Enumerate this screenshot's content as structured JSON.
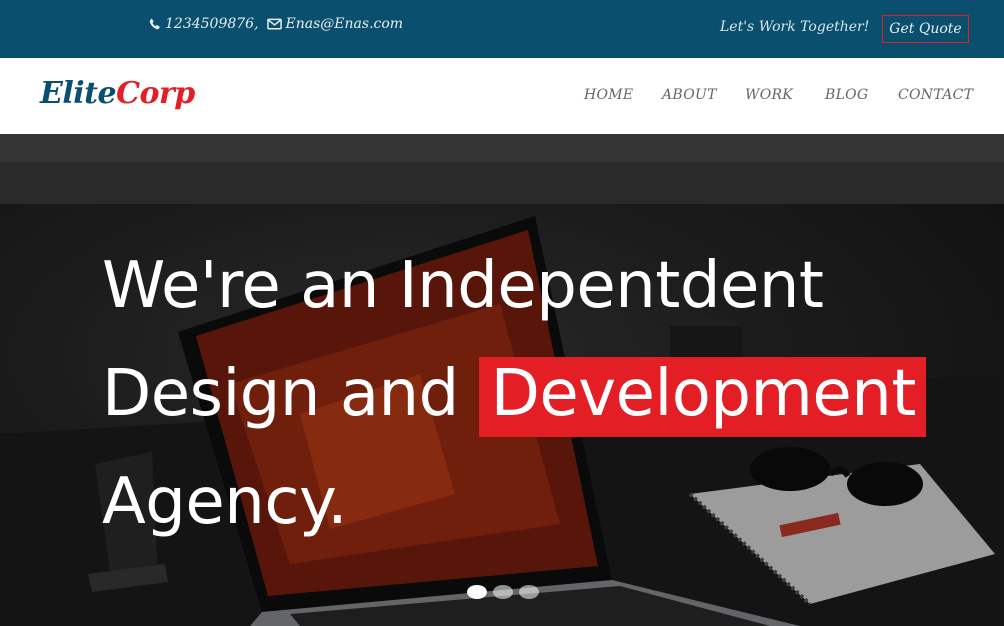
{
  "topbar": {
    "phone": "1234509876,",
    "email": "Enas@Enas.com",
    "tagline": "Let's Work Together!",
    "quote_label": "Get Quote"
  },
  "brand": {
    "part1": "Elite",
    "part2": "Corp"
  },
  "nav": {
    "items": [
      {
        "label": "HOME"
      },
      {
        "label": "ABOUT"
      },
      {
        "label": "WORK"
      },
      {
        "label": "BLOG"
      },
      {
        "label": "CONTACT"
      }
    ],
    "active_index": 1
  },
  "hero": {
    "line1": "We're an Indepentdent",
    "line2_before": "Design and ",
    "line2_highlight": "Development",
    "line3": "Agency.",
    "slide_count": 3,
    "active_slide": 1
  },
  "colors": {
    "topbar": "#0a4f6e",
    "accent": "#e31e24",
    "nav_text": "#666666"
  },
  "icons": [
    "phone-icon",
    "envelope-icon"
  ]
}
